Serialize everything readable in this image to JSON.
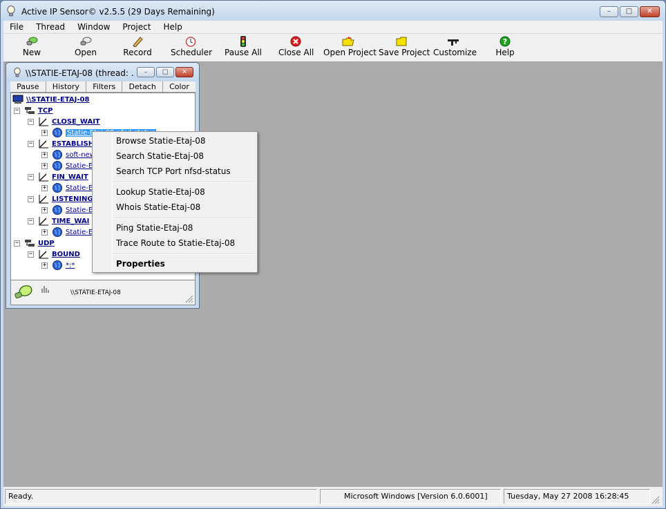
{
  "window": {
    "title": "Active IP Sensor© v2.5.5 (29 Days Remaining)",
    "min_glyph": "–",
    "max_glyph": "□",
    "close_glyph": "✕"
  },
  "menu": [
    "File",
    "Thread",
    "Window",
    "Project",
    "Help"
  ],
  "toolbar": [
    {
      "label": "New",
      "icon": "new-icon"
    },
    {
      "label": "Open",
      "icon": "open-icon"
    },
    {
      "label": "Record",
      "icon": "record-icon"
    },
    {
      "label": "Scheduler",
      "icon": "clock-icon"
    },
    {
      "label": "Pause All",
      "icon": "traffic-light-icon"
    },
    {
      "label": "Close All",
      "icon": "close-circle-icon"
    },
    {
      "label": "Open Project",
      "icon": "folder-open-icon"
    },
    {
      "label": "Save Project",
      "icon": "folder-save-icon"
    },
    {
      "label": "Customize",
      "icon": "tools-icon"
    },
    {
      "label": "Help",
      "icon": "help-icon"
    }
  ],
  "child": {
    "title": "\\\\STATIE-ETAJ-08 (thread: ...",
    "tabs": [
      "Pause",
      "History",
      "Filters",
      "Detach",
      "Color"
    ],
    "tree": {
      "root": "\\\\STATIE-ETAJ-08",
      "tcp": "TCP",
      "close_wait": "CLOSE_WAIT",
      "close_wait_item": "Statie-Etaj-08:nfsd-status",
      "established": "ESTABLISH",
      "est_item1": "soft-new",
      "est_item2": "Statie-Et",
      "fin_wait": "FIN_WAIT",
      "fin_item": "Statie-Et",
      "listening": "LISTENING",
      "listen_item": "Statie-Et",
      "time_wait": "TIME_WAI",
      "time_item": "Statie-Et",
      "udp": "UDP",
      "bound": "BOUND",
      "bound_item": "*:*"
    },
    "footer_host": "\\\\STATIE-ETAJ-08"
  },
  "context_menu": {
    "browse": "Browse Statie-Etaj-08",
    "search": "Search Statie-Etaj-08",
    "search_port": "Search TCP Port nfsd-status",
    "lookup": "Lookup Statie-Etaj-08",
    "whois": "Whois Statie-Etaj-08",
    "ping": "Ping Statie-Etaj-08",
    "trace": "Trace Route to Statie-Etaj-08",
    "properties": "Properties"
  },
  "status": {
    "left": "Ready.",
    "middle": "Microsoft Windows [Version 6.0.6001]",
    "right": "Tuesday, May 27 2008 16:28:45"
  }
}
